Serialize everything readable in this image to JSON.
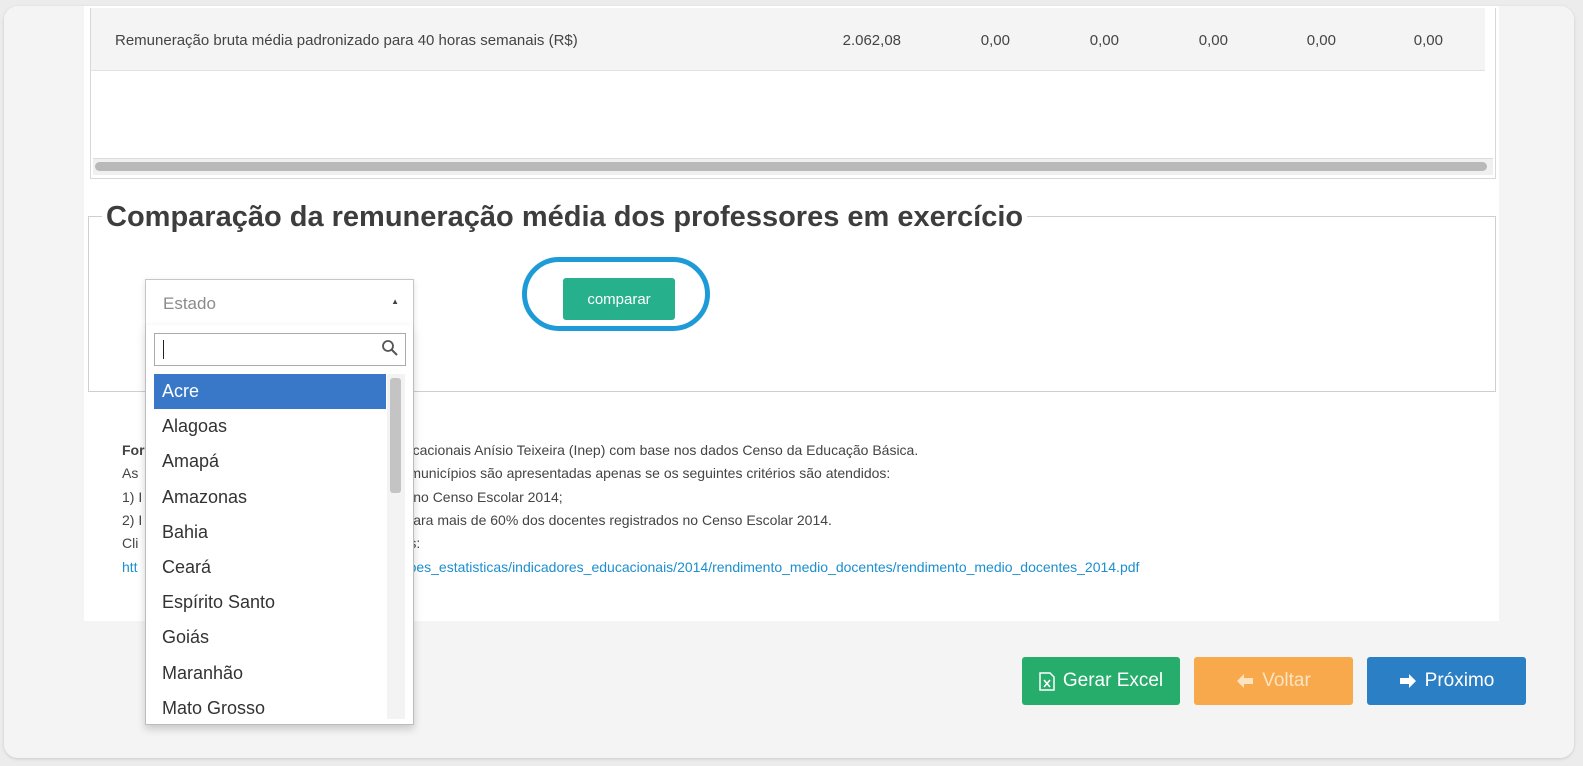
{
  "table": {
    "row_label": "Remuneração bruta média padronizado para 40 horas semanais (R$)",
    "values": [
      "2.062,08",
      "0,00",
      "0,00",
      "0,00",
      "0,00",
      "0,00"
    ]
  },
  "comparison": {
    "title": "Comparação da remuneração média dos professores em exercício",
    "select_placeholder": "Estado",
    "compare_label": "comparar",
    "search_value": "",
    "states": [
      "Acre",
      "Alagoas",
      "Amapá",
      "Amazonas",
      "Bahia",
      "Ceará",
      "Espírito Santo",
      "Goiás",
      "Maranhão",
      "Mato Grosso"
    ],
    "highlighted_state": "Acre"
  },
  "notes": {
    "l1_bold": "For",
    "l1": "e Pesquisas Educacionais Anísio Teixeira (Inep) com base nos dados Censo da Educação Básica.",
    "l2a": "As",
    "l2": "municípios são apresentadas apenas se os seguintes critérios são atendidos:",
    "l3a": "1) I",
    "l3": "no Censo Escolar 2014;",
    "l4a": "2) I",
    "l4": "ara mais de 60% dos docentes registrados no Censo Escolar 2014.",
    "l5a": "Cli",
    "l5": "s:",
    "l6a": "htt",
    "l6": "coes_estatisticas/indicadores_educacionais/2014/rendimento_medio_docentes/rendimento_medio_docentes_2014.pdf"
  },
  "footer": {
    "excel_label": "Gerar Excel",
    "back_label": "Voltar",
    "next_label": "Próximo"
  },
  "colors": {
    "compare_button": "#26b08c",
    "highlight_ring": "#1e9bd7",
    "excel_button": "#26ad6c",
    "back_button": "#f7a94b",
    "next_button": "#2b7fc4",
    "active_option": "#3977c8",
    "link": "#1b8fcf"
  }
}
